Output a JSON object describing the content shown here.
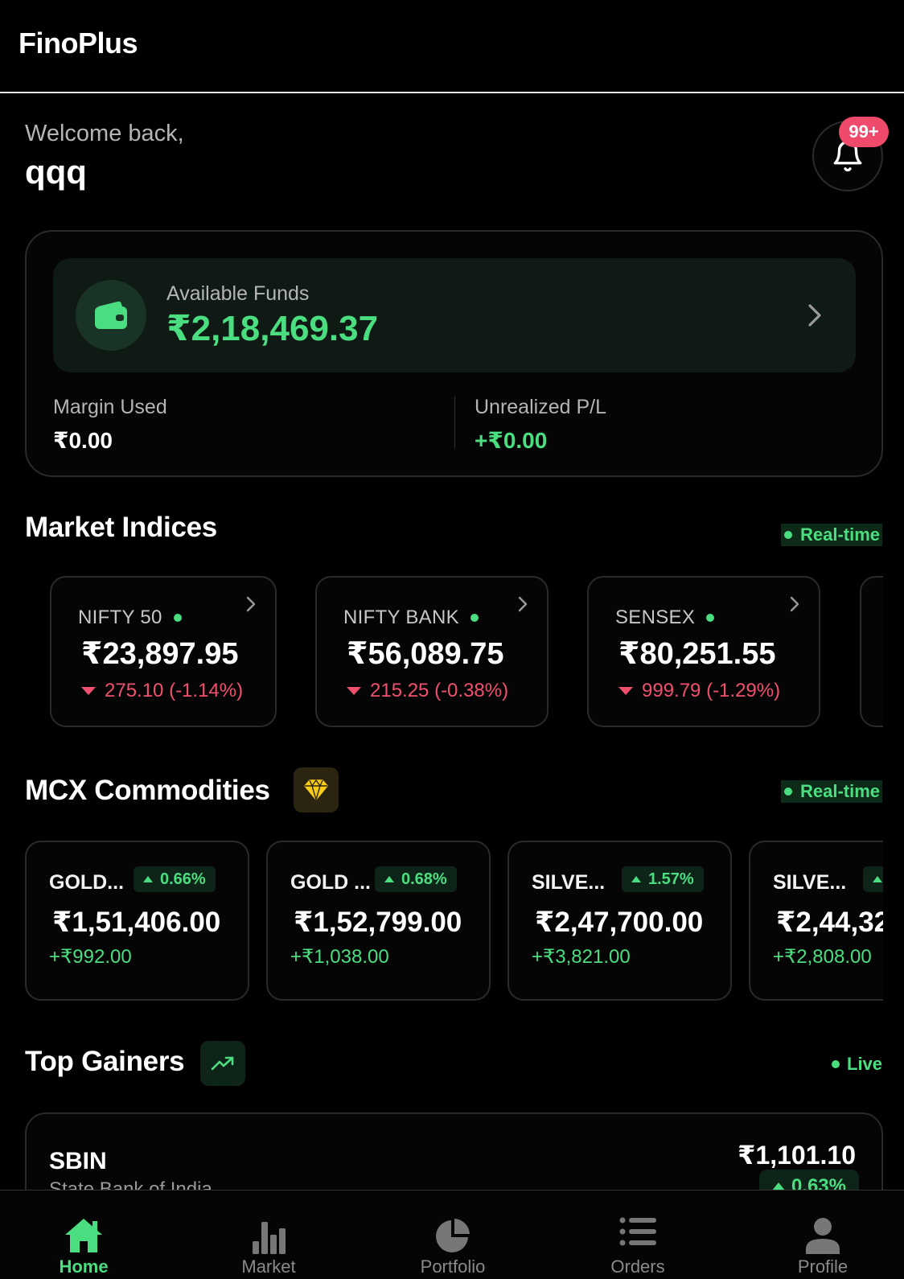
{
  "app": {
    "title": "FinoPlus"
  },
  "header": {
    "welcome": "Welcome back,",
    "username": "qqq",
    "notification_count": "99+"
  },
  "funds": {
    "available_label": "Available Funds",
    "available_value": "₹2,18,469.37",
    "margin_label": "Margin Used",
    "margin_value": "₹0.00",
    "pl_label": "Unrealized P/L",
    "pl_value": "+₹0.00"
  },
  "market_indices": {
    "title": "Market Indices",
    "status": "Real-time",
    "items": [
      {
        "name": "NIFTY 50",
        "value": "₹23,897.95",
        "change": "275.10 (-1.14%)"
      },
      {
        "name": "NIFTY BANK",
        "value": "₹56,089.75",
        "change": "215.25 (-0.38%)"
      },
      {
        "name": "SENSEX",
        "value": "₹80,251.55",
        "change": "999.79 (-1.29%)"
      }
    ]
  },
  "commodities": {
    "title": "MCX Commodities",
    "status": "Real-time",
    "items": [
      {
        "name": "GOLD...",
        "pct": "0.66%",
        "value": "₹1,51,406.00",
        "change": "+₹992.00"
      },
      {
        "name": "GOLD ...",
        "pct": "0.68%",
        "value": "₹1,52,799.00",
        "change": "+₹1,038.00"
      },
      {
        "name": "SILVE...",
        "pct": "1.57%",
        "value": "₹2,47,700.00",
        "change": "+₹3,821.00"
      },
      {
        "name": "SILVE...",
        "pct": "",
        "value": "₹2,44,32",
        "change": "+₹2,808.00"
      }
    ]
  },
  "top_gainers": {
    "title": "Top Gainers",
    "status": "Live",
    "items": [
      {
        "symbol": "SBIN",
        "name": "State Bank of India",
        "price": "₹1,101.10",
        "pct": "0.63%"
      }
    ]
  },
  "nav": {
    "items": [
      {
        "label": "Home",
        "icon": "home-icon",
        "active": true
      },
      {
        "label": "Market",
        "icon": "bar-chart-icon",
        "active": false
      },
      {
        "label": "Portfolio",
        "icon": "pie-chart-icon",
        "active": false
      },
      {
        "label": "Orders",
        "icon": "list-icon",
        "active": false
      },
      {
        "label": "Profile",
        "icon": "user-icon",
        "active": false
      }
    ]
  },
  "colors": {
    "accent": "#4ade80",
    "negative": "#f0506e",
    "badge": "#ef4a6b",
    "gold": "#facc15"
  }
}
